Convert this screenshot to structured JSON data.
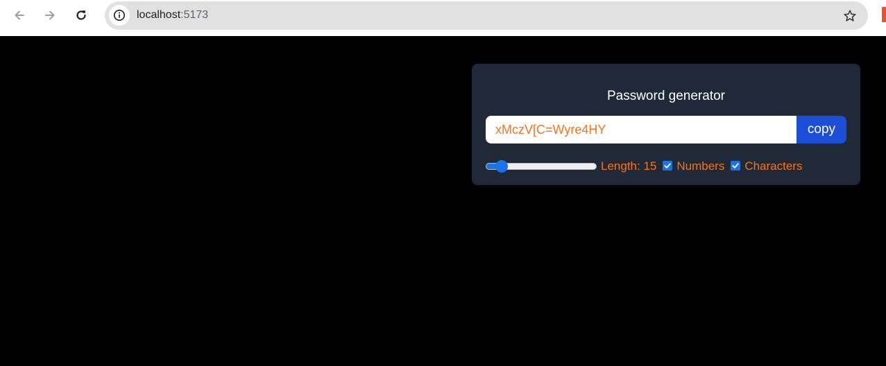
{
  "browser": {
    "url_host": "localhost",
    "url_port": ":5173",
    "icons": {
      "back": "back-arrow-icon",
      "forward": "forward-arrow-icon",
      "reload": "reload-icon",
      "site_info": "info-icon",
      "bookmark": "star-icon"
    }
  },
  "generator": {
    "title": "Password generator",
    "password": "xMczV[C=Wyre4HY",
    "copy_label": "copy",
    "length_label": "Length: 15",
    "length_value": 15,
    "length_min": 6,
    "length_max": 100,
    "numbers_label": "Numbers",
    "numbers_checked": true,
    "characters_label": "Characters",
    "characters_checked": true
  },
  "colors": {
    "page_background": "#000000",
    "card_background": "#1f2937",
    "accent_text": "#f97316",
    "copy_button": "#1d4ed8",
    "control_blue": "#1a73e8"
  }
}
